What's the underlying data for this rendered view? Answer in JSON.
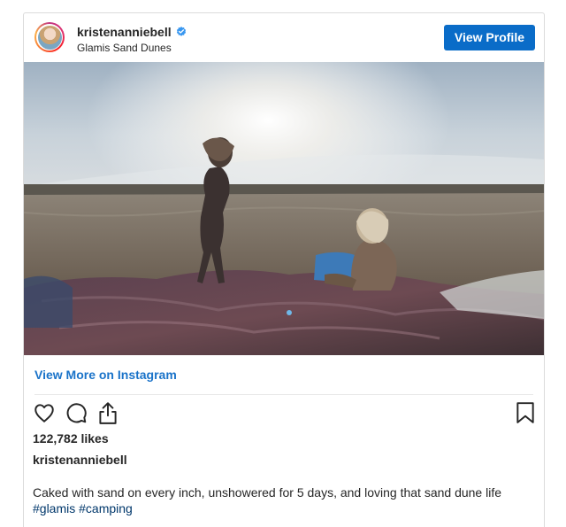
{
  "post": {
    "username": "kristenanniebell",
    "verified": true,
    "location": "Glamis Sand Dunes",
    "view_profile_label": "View Profile",
    "view_more_label": "View More on Instagram",
    "likes": "122,782 likes",
    "caption_username": "kristenanniebell",
    "caption_text": "Caked with sand on every inch, unshowered for 5 days, and loving that sand dune life",
    "hashtags": "#glamis #camping"
  },
  "icons": [
    "heart-icon",
    "comment-icon",
    "share-icon",
    "bookmark-icon",
    "verified-badge-icon"
  ],
  "colors": {
    "button": "#0a6cc8",
    "link": "#1a73c9",
    "verified": "#3897f0",
    "hashtag": "#00376b"
  }
}
